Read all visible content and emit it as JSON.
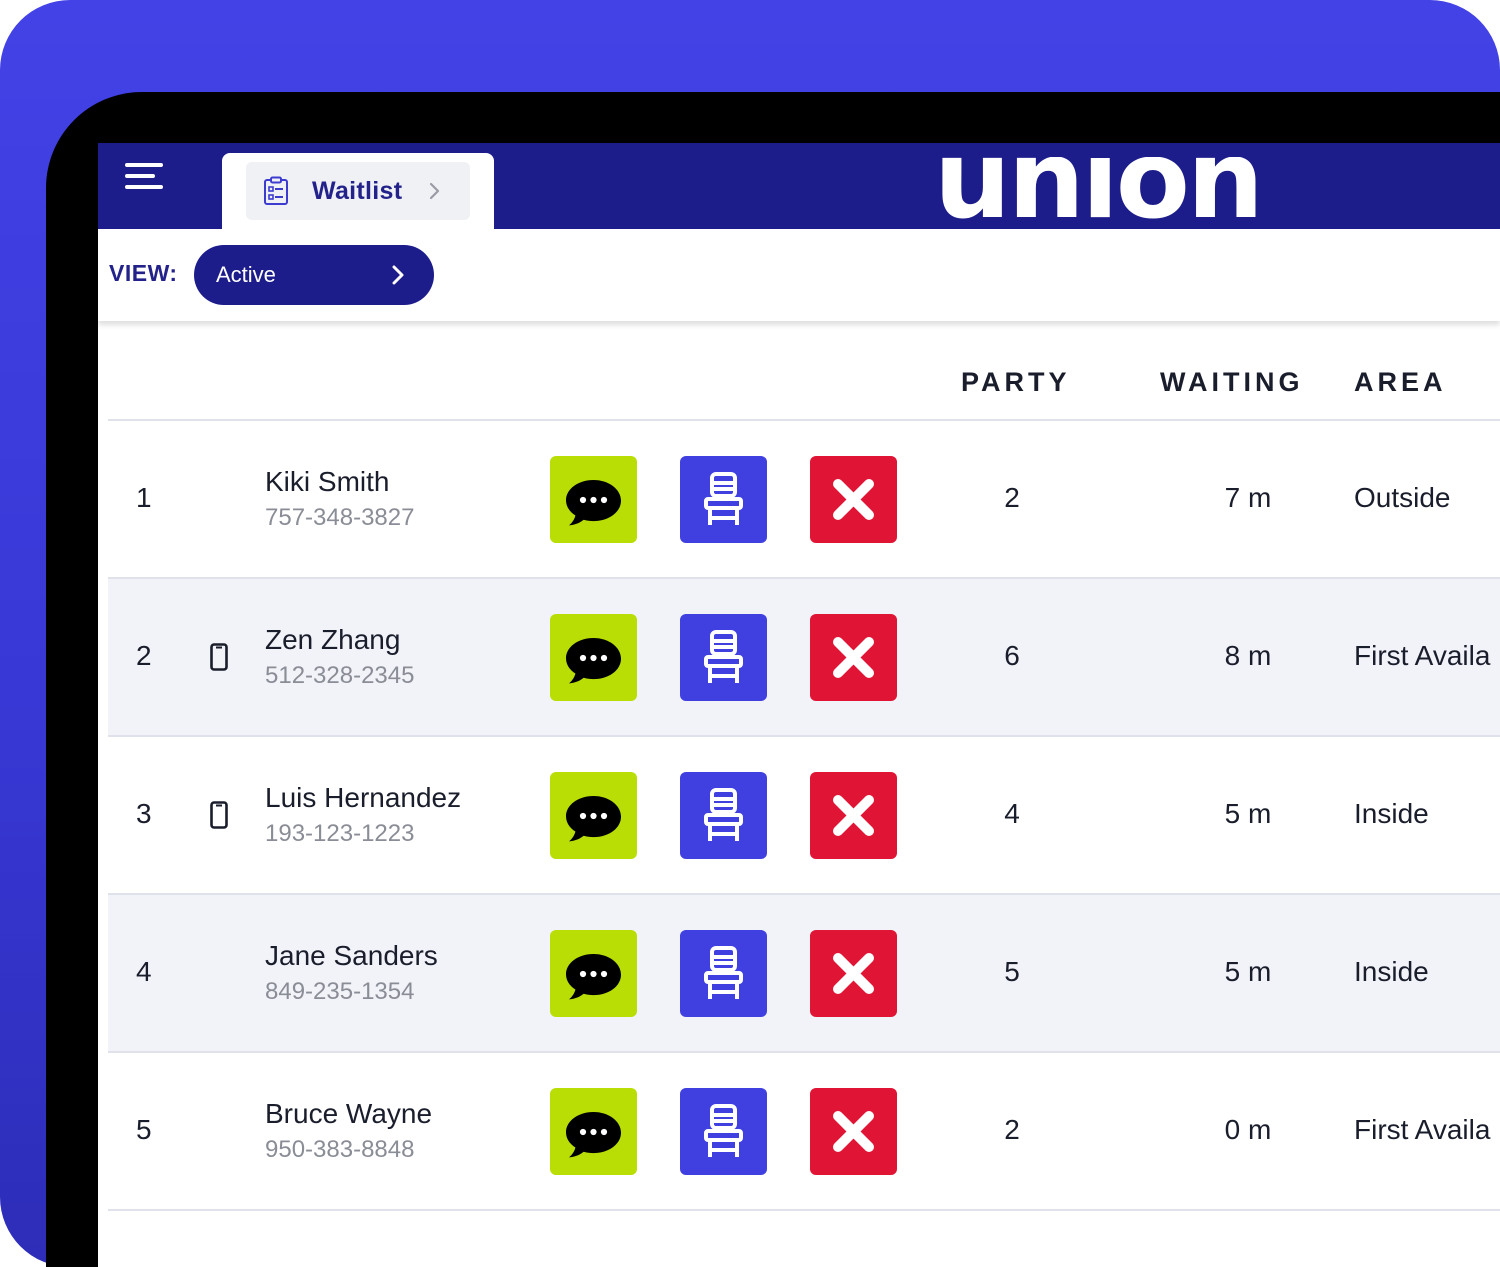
{
  "app": {
    "brand": "union",
    "tab": {
      "label": "Waitlist"
    }
  },
  "view": {
    "label": "VIEW:",
    "selected": "Active"
  },
  "table": {
    "headers": {
      "party": "PARTY",
      "waiting": "WAITING",
      "area": "AREA"
    },
    "rows": [
      {
        "index": "1",
        "name": "Kiki Smith",
        "phone": "757-348-3827",
        "mobile": false,
        "party": "2",
        "waiting": "7 m",
        "area": "Outside"
      },
      {
        "index": "2",
        "name": "Zen Zhang",
        "phone": "512-328-2345",
        "mobile": true,
        "party": "6",
        "waiting": "8 m",
        "area": "First Availa"
      },
      {
        "index": "3",
        "name": "Luis Hernandez",
        "phone": "193-123-1223",
        "mobile": true,
        "party": "4",
        "waiting": "5 m",
        "area": "Inside"
      },
      {
        "index": "4",
        "name": "Jane Sanders",
        "phone": "849-235-1354",
        "mobile": false,
        "party": "5",
        "waiting": "5 m",
        "area": "Inside"
      },
      {
        "index": "5",
        "name": "Bruce Wayne",
        "phone": "950-383-8848",
        "mobile": false,
        "party": "2",
        "waiting": "0 m",
        "area": "First Availa"
      }
    ]
  },
  "icons": {
    "menu": "hamburger-menu-icon",
    "tab": "clipboard-list-icon",
    "chevron": "chevron-right-icon",
    "mobile": "mobile-phone-icon",
    "message": "chat-bubble-icon",
    "seat": "chair-icon",
    "remove": "close-x-icon"
  },
  "colors": {
    "background": "#4242e6",
    "topbar": "#1c1c8a",
    "message_button": "#b8de06",
    "seat_button": "#4040e0",
    "remove_button": "#e01434",
    "row_alt": "#f2f3f8"
  }
}
